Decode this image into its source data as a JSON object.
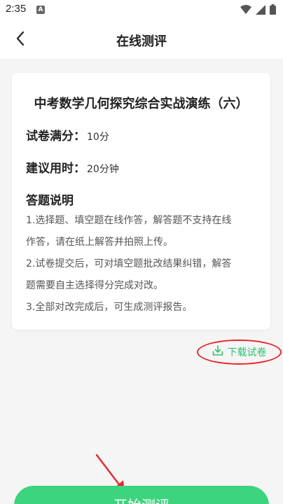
{
  "status_bar": {
    "time": "2:35",
    "notification_letter": "A",
    "icons": [
      "wifi-icon",
      "signal-icon",
      "battery-icon"
    ]
  },
  "header": {
    "back_icon": "chevron-left-icon",
    "title": "在线测评"
  },
  "card": {
    "title": "中考数学几何探究综合实战演练（六）",
    "full_score_label": "试卷满分：",
    "full_score_value": "10分",
    "time_label": "建议用时：",
    "time_value": "20分钟",
    "instructions_heading": "答题说明",
    "instruction_lines": [
      "1.选择题、填空题在线作答，解答题不支持在线",
      "作答，请在纸上解答并拍照上传。",
      "2.试卷提交后，可对填空题批改结果纠错，解答",
      "题需要自主选择得分完成对改。",
      "3.全部对改完成后，可生成测评报告。"
    ]
  },
  "download": {
    "icon": "download-icon",
    "label": "下载试卷"
  },
  "start_button": {
    "label": "开始测评"
  },
  "colors": {
    "accent_green": "#3cd47d",
    "download_green": "#2fbf71",
    "annotation_red": "#e8262b",
    "background": "#f5f5f5"
  }
}
